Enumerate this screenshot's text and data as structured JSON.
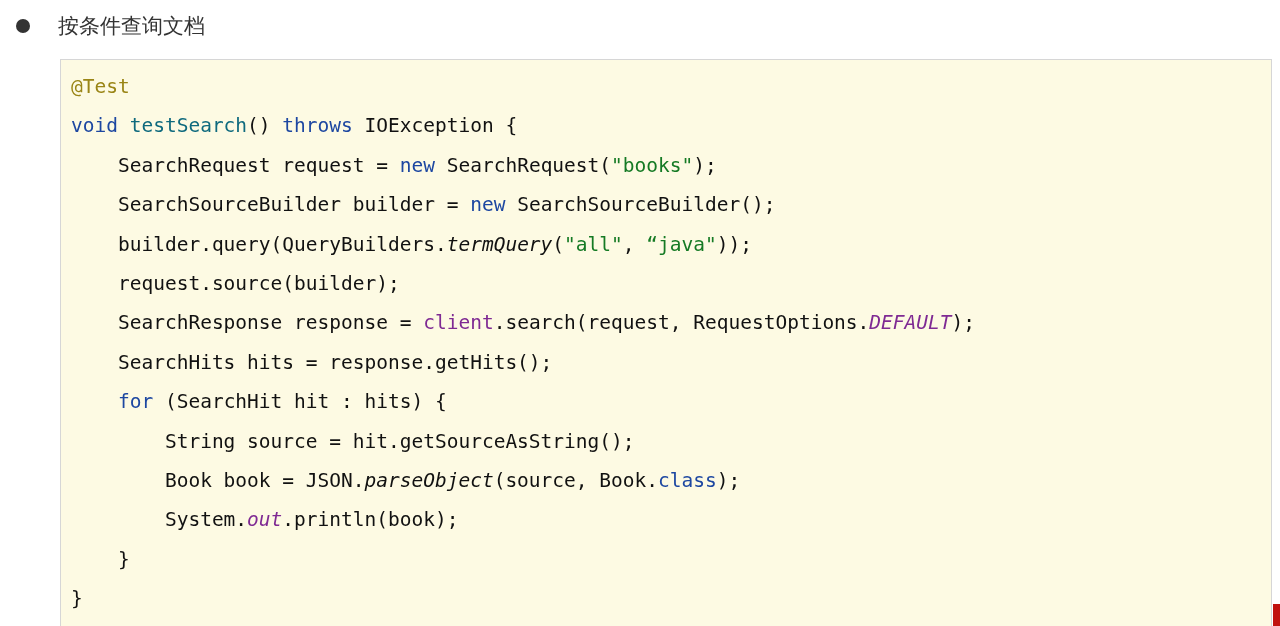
{
  "heading": {
    "text": "按条件查询文档"
  },
  "code_lines": [
    [
      {
        "kind": "annotation",
        "text": "@Test"
      }
    ],
    [
      {
        "kind": "keyword",
        "text": "void "
      },
      {
        "kind": "method-decl",
        "text": "testSearch"
      },
      {
        "kind": "plain",
        "text": "() "
      },
      {
        "kind": "keyword",
        "text": "throws"
      },
      {
        "kind": "plain",
        "text": " IOException {"
      }
    ],
    [
      {
        "kind": "plain",
        "text": "    SearchRequest request = "
      },
      {
        "kind": "keyword",
        "text": "new"
      },
      {
        "kind": "plain",
        "text": " SearchRequest("
      },
      {
        "kind": "string",
        "text": "\"books\""
      },
      {
        "kind": "plain",
        "text": ");"
      }
    ],
    [
      {
        "kind": "plain",
        "text": "    SearchSourceBuilder builder = "
      },
      {
        "kind": "keyword",
        "text": "new"
      },
      {
        "kind": "plain",
        "text": " SearchSourceBuilder();"
      }
    ],
    [
      {
        "kind": "plain",
        "text": "    builder.query(QueryBuilders."
      },
      {
        "kind": "static-method",
        "text": "termQuery"
      },
      {
        "kind": "plain",
        "text": "("
      },
      {
        "kind": "string",
        "text": "\"all\""
      },
      {
        "kind": "plain",
        "text": ", "
      },
      {
        "kind": "string",
        "text": "“java\""
      },
      {
        "kind": "plain",
        "text": "));"
      }
    ],
    [
      {
        "kind": "plain",
        "text": "    request.source(builder);"
      }
    ],
    [
      {
        "kind": "plain",
        "text": "    SearchResponse response = "
      },
      {
        "kind": "field",
        "text": "client"
      },
      {
        "kind": "plain",
        "text": ".search(request, RequestOptions."
      },
      {
        "kind": "static-field",
        "text": "DEFAULT"
      },
      {
        "kind": "plain",
        "text": ");"
      }
    ],
    [
      {
        "kind": "plain",
        "text": "    SearchHits hits = response.getHits();"
      }
    ],
    [
      {
        "kind": "keyword",
        "text": "    for"
      },
      {
        "kind": "plain",
        "text": " (SearchHit hit : hits) {"
      }
    ],
    [
      {
        "kind": "plain",
        "text": "        String source = hit.getSourceAsString();"
      }
    ],
    [
      {
        "kind": "plain",
        "text": "        Book book = JSON."
      },
      {
        "kind": "static-method",
        "text": "parseObject"
      },
      {
        "kind": "plain",
        "text": "(source, Book."
      },
      {
        "kind": "keyword",
        "text": "class"
      },
      {
        "kind": "plain",
        "text": ");"
      }
    ],
    [
      {
        "kind": "plain",
        "text": "        System."
      },
      {
        "kind": "static-field",
        "text": "out"
      },
      {
        "kind": "plain",
        "text": ".println(book);"
      }
    ],
    [
      {
        "kind": "plain",
        "text": "    }"
      }
    ],
    [
      {
        "kind": "plain",
        "text": "}"
      }
    ]
  ]
}
